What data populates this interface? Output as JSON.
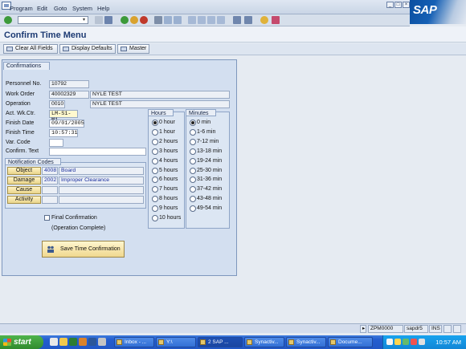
{
  "menu": {
    "items": [
      "Program",
      "Edit",
      "Goto",
      "System",
      "Help"
    ],
    "logo": "SAP"
  },
  "title": "Confirm Time Menu",
  "toolbar": {
    "buttons": [
      "Clear All Fields",
      "Display Defaults",
      "Master"
    ]
  },
  "confirmations": {
    "tab_label": "Confirmations",
    "fields": {
      "personnel_no": {
        "label": "Personnel No.",
        "value": "10792"
      },
      "work_order": {
        "label": "Work Order",
        "value": "40002329",
        "desc": "NYLE TEST"
      },
      "operation": {
        "label": "Operation",
        "value": "0010",
        "desc": "NYLE TEST"
      },
      "act_wk_ctr": {
        "label": "Act. Wk.Ctr.",
        "value": "LM-S1-M1"
      },
      "finish_date": {
        "label": "Finish Date",
        "value": "09/01/2005"
      },
      "finish_time": {
        "label": "Finish Time",
        "value": "10:57:31"
      },
      "var_code": {
        "label": "Var. Code",
        "value": ""
      },
      "confirm_text": {
        "label": "Confirm. Text",
        "value": ""
      }
    }
  },
  "notification_codes": {
    "title": "Notification Codes",
    "rows": [
      {
        "button": "Object",
        "code": "4008",
        "desc": "Board"
      },
      {
        "button": "Damage",
        "code": "2002",
        "desc": "Improper Clearance"
      },
      {
        "button": "Cause",
        "code": "",
        "desc": ""
      },
      {
        "button": "Activity",
        "code": "",
        "desc": ""
      }
    ]
  },
  "final_confirmation": {
    "label": "Final Confirmation",
    "sublabel": "(Operation Complete)",
    "checked": false
  },
  "save_button": "Save Time Confirmation",
  "hours": {
    "title": "Hours",
    "selected": "0 hour",
    "options": [
      "0 hour",
      "1 hour",
      "2 hours",
      "3 hours",
      "4 hours",
      "5 hours",
      "6 hours",
      "7 hours",
      "8 hours",
      "9 hours",
      "10 hours"
    ]
  },
  "minutes": {
    "title": "Minutes",
    "selected": "0 min",
    "options": [
      "0 min",
      "1-6 min",
      "7-12 min",
      "13-18 min",
      "19-24 min",
      "25-30 min",
      "31-36 min",
      "37-42 min",
      "43-48 min",
      "49-54 min"
    ]
  },
  "statusbar": {
    "transaction": "ZPM0000",
    "server": "sapdr5",
    "mode": "INS"
  },
  "taskbar": {
    "start": "start",
    "tasks": [
      "Inbox - ...",
      "Y:\\",
      "2 SAP ...",
      "Synactiv...",
      "Synactiv...",
      "Docume..."
    ],
    "clock": "10:57 AM"
  },
  "colors": {
    "accent": "#1c3a73",
    "panel": "#d3dff0",
    "button_yellow": "#f0d88e",
    "taskbar": "#245ecf"
  }
}
